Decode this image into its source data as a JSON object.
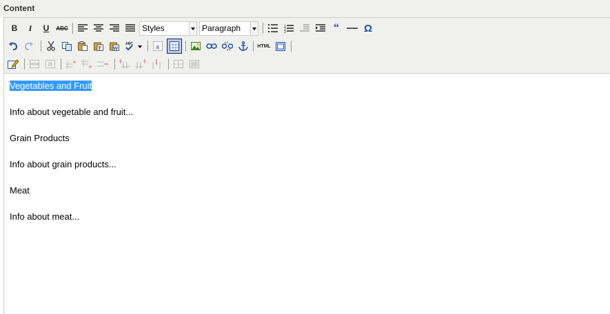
{
  "section_label": "Content",
  "toolbar": {
    "styles_select": "Styles",
    "format_select": "Paragraph",
    "buttons": {
      "bold": "B",
      "italic": "I",
      "underline": "U",
      "strike": "ABC",
      "html": "HTML",
      "omega": "Ω"
    }
  },
  "content": {
    "paragraphs": [
      "Vegetables and Fruit",
      "Info about vegetable and fruit...",
      "Grain Products",
      "Info about grain products...",
      "Meat",
      "Info about meat..."
    ]
  }
}
